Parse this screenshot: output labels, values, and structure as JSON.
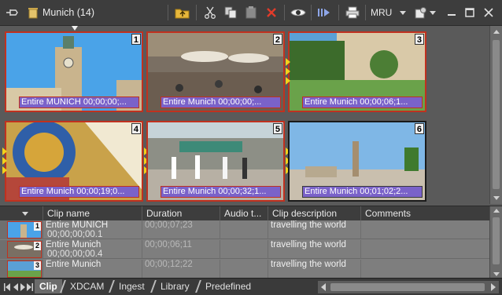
{
  "window": {
    "bin_title": "Munich (14)",
    "mru_label": "MRU"
  },
  "toolbar": {
    "icons": [
      "pin-icon",
      "bin-icon",
      "folder-up-icon",
      "cut-icon",
      "copy-icon",
      "paste-icon",
      "delete-icon",
      "view-icon",
      "send-icon",
      "print-icon",
      "mru-dropdown-icon",
      "bin-settings-icon",
      "minimize-icon",
      "maximize-icon",
      "close-icon"
    ]
  },
  "clips": [
    {
      "number": "1",
      "label": "Entire MUNICH 00;00;00;..."
    },
    {
      "number": "2",
      "label": "Entire Munich 00;00;00;..."
    },
    {
      "number": "3",
      "label": "Entire Munich 00;00;06;1..."
    },
    {
      "number": "4",
      "label": "Entire Munich 00;00;19;0..."
    },
    {
      "number": "5",
      "label": "Entire Munich 00;00;32;1..."
    },
    {
      "number": "6",
      "label": "Entire Munich 00;01;02;2..."
    }
  ],
  "list": {
    "columns": [
      "Clip name",
      "Duration",
      "Audio t...",
      "Clip description",
      "Comments"
    ],
    "rows": [
      {
        "num": "1",
        "name": "Entire MUNICH",
        "tc": "00;00;00;00.1",
        "duration": "00;00;07;23",
        "audio": "",
        "description": "travelling the world",
        "comments": ""
      },
      {
        "num": "2",
        "name": "Entire Munich",
        "tc": "00;00;00;00.4",
        "duration": "00;00;06;11",
        "audio": "",
        "description": "travelling the world",
        "comments": ""
      },
      {
        "num": "3",
        "name": "Entire Munich",
        "tc": "",
        "duration": "00;00;12;22",
        "audio": "",
        "description": "travelling the world",
        "comments": ""
      }
    ]
  },
  "tabs": [
    "Clip",
    "XDCAM",
    "Ingest",
    "Library",
    "Predefined"
  ],
  "colors": {
    "selection_border": "#c0311f",
    "label_bg": "#7a62c9",
    "marker": "#f2d21b"
  }
}
